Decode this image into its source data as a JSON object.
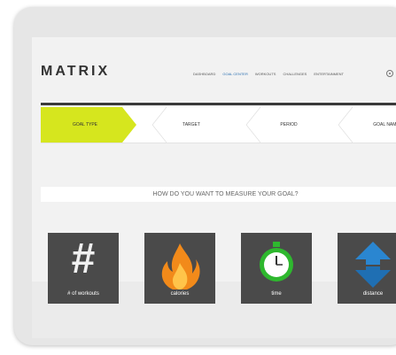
{
  "header": {
    "logo": "MATRIX",
    "nav": [
      {
        "label": "Dashboard",
        "active": false
      },
      {
        "label": "Goal Center",
        "active": true
      },
      {
        "label": "Workouts",
        "active": false
      },
      {
        "label": "Challenges",
        "active": false
      },
      {
        "label": "Entertainment",
        "active": false
      }
    ]
  },
  "steps": [
    {
      "label": "Goal Type",
      "active": true
    },
    {
      "label": "Target",
      "active": false
    },
    {
      "label": "Period",
      "active": false
    },
    {
      "label": "Goal Name",
      "active": false
    }
  ],
  "question": "HOW DO YOU WANT TO MEASURE YOUR GOAL?",
  "tiles": [
    {
      "label": "# of workouts",
      "icon": "hash-icon",
      "symbol": "#"
    },
    {
      "label": "calories",
      "icon": "flame-icon"
    },
    {
      "label": "time",
      "icon": "stopwatch-icon"
    },
    {
      "label": "distance",
      "icon": "distance-arrows-icon"
    }
  ],
  "colors": {
    "accent": "#d6e61e",
    "tile_bg": "#4a4a4a",
    "nav_active": "#2a6fb1",
    "flame": "#f28a1a",
    "clock": "#2eb82e",
    "arrows": "#2a86d1"
  }
}
